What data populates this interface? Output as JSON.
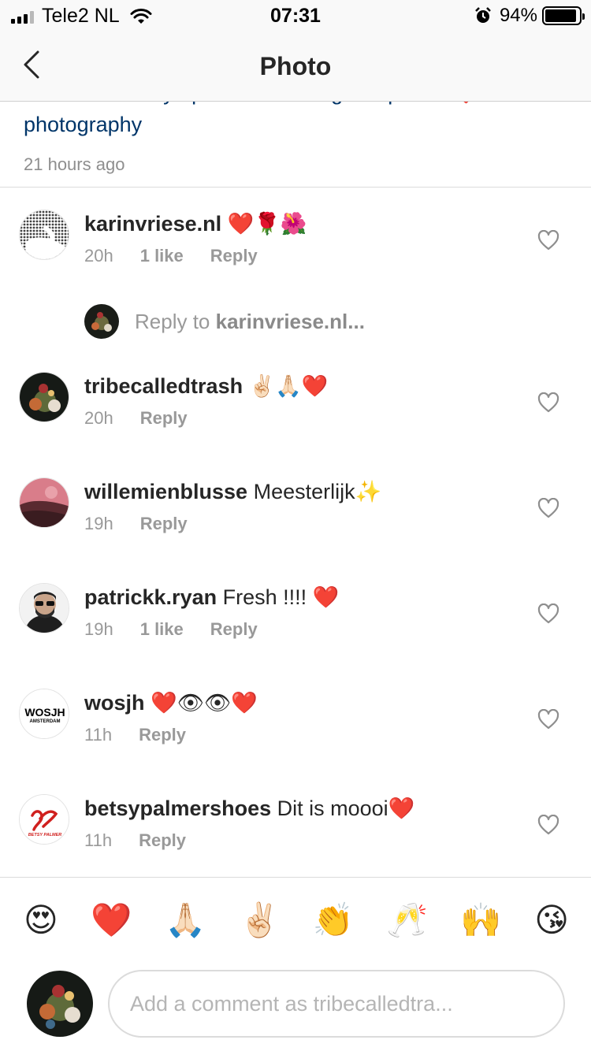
{
  "status_bar": {
    "carrier": "Tele2 NL",
    "time": "07:31",
    "battery_percent": "94%",
    "battery_level": 0.94
  },
  "nav": {
    "title": "Photo"
  },
  "caption": {
    "hidden_line": "#visualcreativity #positivevibes #getinspired #❤️",
    "text": "photography",
    "time": "21 hours ago"
  },
  "comments": [
    {
      "user": "karinvriese.nl",
      "text": "❤️🌹🌺",
      "time": "20h",
      "likes": "1 like",
      "reply": "Reply"
    },
    {
      "user": "tribecalledtrash",
      "text": "✌🏻🙏🏻❤️",
      "time": "20h",
      "reply": "Reply"
    },
    {
      "user": "willemienblusse",
      "text": "Meesterlijk✨",
      "time": "19h",
      "reply": "Reply"
    },
    {
      "user": "patrickk.ryan",
      "text": "Fresh !!!! ❤️",
      "time": "19h",
      "likes": "1 like",
      "reply": "Reply"
    },
    {
      "user": "wosjh",
      "text": "❤️👁👁❤️",
      "time": "11h",
      "reply": "Reply"
    },
    {
      "user": "betsypalmershoes",
      "text": "Dit is moooi❤️",
      "time": "11h",
      "reply": "Reply"
    }
  ],
  "reply_prompt": {
    "prefix": "Reply to ",
    "user": "karinvriese.nl..."
  },
  "avatar_labels": {
    "wosjh_main": "WOSJH",
    "wosjh_sub": "AMSTERDAM",
    "betsy": "BETSY PALMER"
  },
  "emoji_bar": [
    "😍",
    "❤️",
    "🙏🏻",
    "✌🏻",
    "👏",
    "🥂",
    "🙌",
    "😘"
  ],
  "composer": {
    "placeholder": "Add a comment as tribecalledtra..."
  },
  "colors": {
    "link": "#003569",
    "secondary_text": "#999999",
    "heart_red": "#e0262b"
  },
  "icons": {
    "back": "chevron-left-icon",
    "like": "heart-outline-icon",
    "wifi": "wifi-icon",
    "alarm": "alarm-icon",
    "battery": "battery-icon"
  }
}
